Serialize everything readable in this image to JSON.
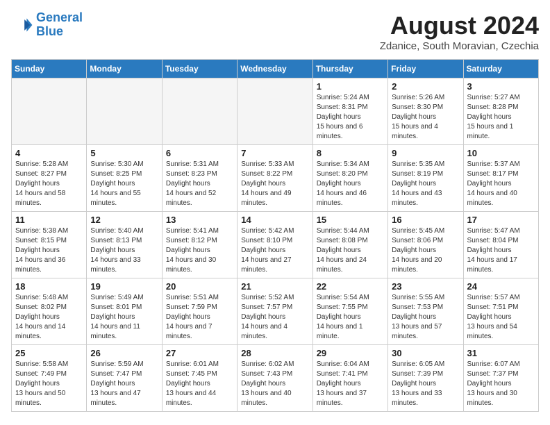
{
  "header": {
    "logo_line1": "General",
    "logo_line2": "Blue",
    "month_year": "August 2024",
    "location": "Zdanice, South Moravian, Czechia"
  },
  "days_of_week": [
    "Sunday",
    "Monday",
    "Tuesday",
    "Wednesday",
    "Thursday",
    "Friday",
    "Saturday"
  ],
  "weeks": [
    [
      {
        "day": "",
        "empty": true
      },
      {
        "day": "",
        "empty": true
      },
      {
        "day": "",
        "empty": true
      },
      {
        "day": "",
        "empty": true
      },
      {
        "day": "1",
        "sunrise": "5:24 AM",
        "sunset": "8:31 PM",
        "daylight": "15 hours and 6 minutes."
      },
      {
        "day": "2",
        "sunrise": "5:26 AM",
        "sunset": "8:30 PM",
        "daylight": "15 hours and 4 minutes."
      },
      {
        "day": "3",
        "sunrise": "5:27 AM",
        "sunset": "8:28 PM",
        "daylight": "15 hours and 1 minute."
      }
    ],
    [
      {
        "day": "4",
        "sunrise": "5:28 AM",
        "sunset": "8:27 PM",
        "daylight": "14 hours and 58 minutes."
      },
      {
        "day": "5",
        "sunrise": "5:30 AM",
        "sunset": "8:25 PM",
        "daylight": "14 hours and 55 minutes."
      },
      {
        "day": "6",
        "sunrise": "5:31 AM",
        "sunset": "8:23 PM",
        "daylight": "14 hours and 52 minutes."
      },
      {
        "day": "7",
        "sunrise": "5:33 AM",
        "sunset": "8:22 PM",
        "daylight": "14 hours and 49 minutes."
      },
      {
        "day": "8",
        "sunrise": "5:34 AM",
        "sunset": "8:20 PM",
        "daylight": "14 hours and 46 minutes."
      },
      {
        "day": "9",
        "sunrise": "5:35 AM",
        "sunset": "8:19 PM",
        "daylight": "14 hours and 43 minutes."
      },
      {
        "day": "10",
        "sunrise": "5:37 AM",
        "sunset": "8:17 PM",
        "daylight": "14 hours and 40 minutes."
      }
    ],
    [
      {
        "day": "11",
        "sunrise": "5:38 AM",
        "sunset": "8:15 PM",
        "daylight": "14 hours and 36 minutes."
      },
      {
        "day": "12",
        "sunrise": "5:40 AM",
        "sunset": "8:13 PM",
        "daylight": "14 hours and 33 minutes."
      },
      {
        "day": "13",
        "sunrise": "5:41 AM",
        "sunset": "8:12 PM",
        "daylight": "14 hours and 30 minutes."
      },
      {
        "day": "14",
        "sunrise": "5:42 AM",
        "sunset": "8:10 PM",
        "daylight": "14 hours and 27 minutes."
      },
      {
        "day": "15",
        "sunrise": "5:44 AM",
        "sunset": "8:08 PM",
        "daylight": "14 hours and 24 minutes."
      },
      {
        "day": "16",
        "sunrise": "5:45 AM",
        "sunset": "8:06 PM",
        "daylight": "14 hours and 20 minutes."
      },
      {
        "day": "17",
        "sunrise": "5:47 AM",
        "sunset": "8:04 PM",
        "daylight": "14 hours and 17 minutes."
      }
    ],
    [
      {
        "day": "18",
        "sunrise": "5:48 AM",
        "sunset": "8:02 PM",
        "daylight": "14 hours and 14 minutes."
      },
      {
        "day": "19",
        "sunrise": "5:49 AM",
        "sunset": "8:01 PM",
        "daylight": "14 hours and 11 minutes."
      },
      {
        "day": "20",
        "sunrise": "5:51 AM",
        "sunset": "7:59 PM",
        "daylight": "14 hours and 7 minutes."
      },
      {
        "day": "21",
        "sunrise": "5:52 AM",
        "sunset": "7:57 PM",
        "daylight": "14 hours and 4 minutes."
      },
      {
        "day": "22",
        "sunrise": "5:54 AM",
        "sunset": "7:55 PM",
        "daylight": "14 hours and 1 minute."
      },
      {
        "day": "23",
        "sunrise": "5:55 AM",
        "sunset": "7:53 PM",
        "daylight": "13 hours and 57 minutes."
      },
      {
        "day": "24",
        "sunrise": "5:57 AM",
        "sunset": "7:51 PM",
        "daylight": "13 hours and 54 minutes."
      }
    ],
    [
      {
        "day": "25",
        "sunrise": "5:58 AM",
        "sunset": "7:49 PM",
        "daylight": "13 hours and 50 minutes."
      },
      {
        "day": "26",
        "sunrise": "5:59 AM",
        "sunset": "7:47 PM",
        "daylight": "13 hours and 47 minutes."
      },
      {
        "day": "27",
        "sunrise": "6:01 AM",
        "sunset": "7:45 PM",
        "daylight": "13 hours and 44 minutes."
      },
      {
        "day": "28",
        "sunrise": "6:02 AM",
        "sunset": "7:43 PM",
        "daylight": "13 hours and 40 minutes."
      },
      {
        "day": "29",
        "sunrise": "6:04 AM",
        "sunset": "7:41 PM",
        "daylight": "13 hours and 37 minutes."
      },
      {
        "day": "30",
        "sunrise": "6:05 AM",
        "sunset": "7:39 PM",
        "daylight": "13 hours and 33 minutes."
      },
      {
        "day": "31",
        "sunrise": "6:07 AM",
        "sunset": "7:37 PM",
        "daylight": "13 hours and 30 minutes."
      }
    ]
  ],
  "labels": {
    "sunrise": "Sunrise:",
    "sunset": "Sunset:",
    "daylight": "Daylight hours"
  }
}
